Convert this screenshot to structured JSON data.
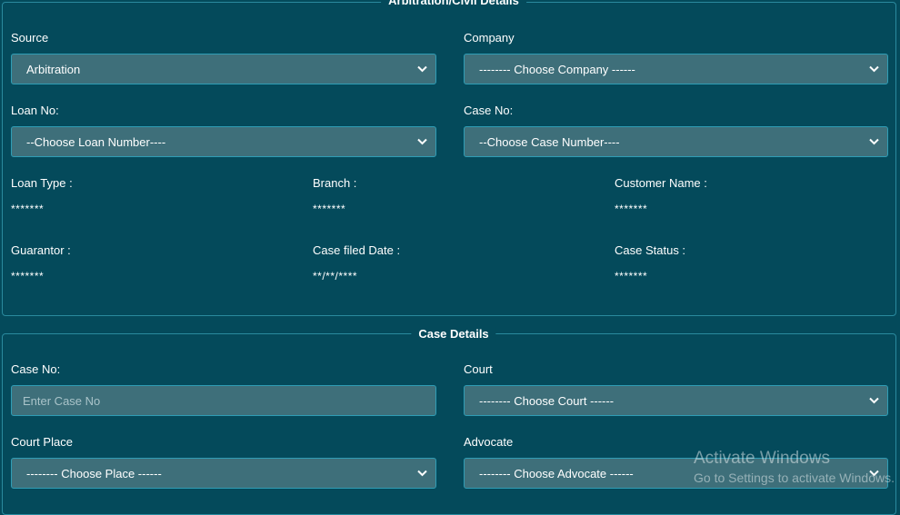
{
  "arbitration": {
    "legend": "Arbitration/Civil Details",
    "source_label": "Source",
    "source_value": "Arbitration",
    "company_label": "Company",
    "company_value": "-------- Choose Company ------",
    "loan_no_label": "Loan No:",
    "loan_no_value": "--Choose Loan Number----",
    "case_no_label": "Case No:",
    "case_no_value": "--Choose Case Number----",
    "loan_type_label": "Loan Type :",
    "loan_type_value": "*******",
    "branch_label": "Branch :",
    "branch_value": "*******",
    "customer_name_label": "Customer Name :",
    "customer_name_value": "*******",
    "guarantor_label": "Guarantor :",
    "guarantor_value": "*******",
    "case_filed_date_label": "Case filed Date :",
    "case_filed_date_value": "**/**/****",
    "case_status_label": "Case Status :",
    "case_status_value": "*******"
  },
  "case_details": {
    "legend": "Case Details",
    "case_no_label": "Case No:",
    "case_no_placeholder": "Enter Case No",
    "court_label": "Court",
    "court_value": "-------- Choose Court ------",
    "court_place_label": "Court Place",
    "court_place_value": "-------- Choose Place ------",
    "advocate_label": "Advocate",
    "advocate_value": "-------- Choose Advocate ------"
  },
  "watermark": {
    "line1": "Activate Windows",
    "line2": "Go to Settings to activate Windows."
  },
  "colors": {
    "background": "#044a5b",
    "field": "#3e6f7a",
    "border": "#2f9db5"
  }
}
